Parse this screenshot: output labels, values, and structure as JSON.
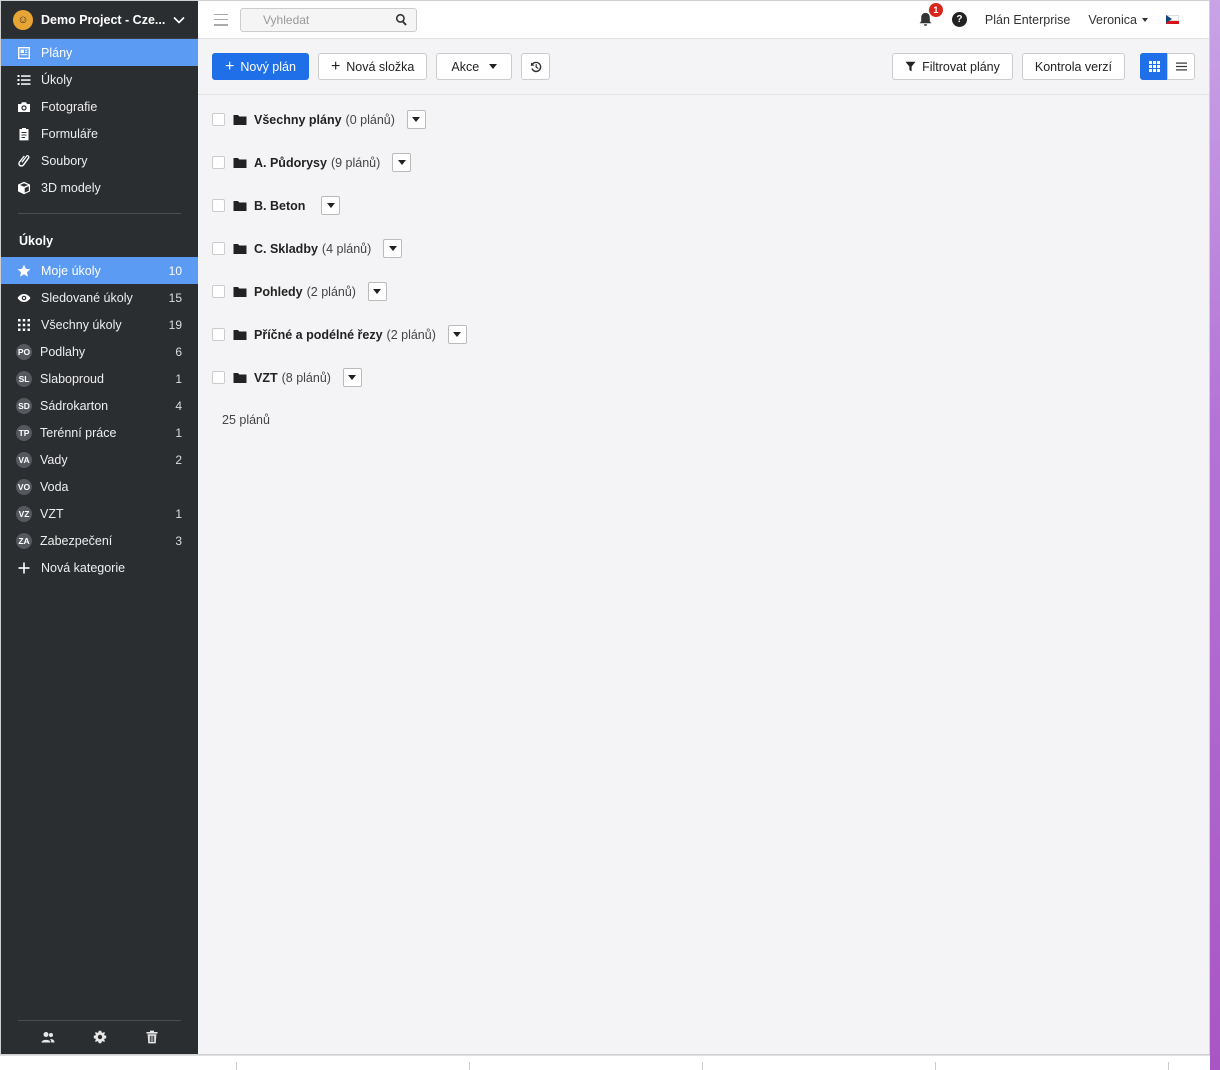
{
  "project": {
    "name": "Demo Project - Cze..."
  },
  "nav": [
    {
      "label": "Plány",
      "icon": "plans-icon",
      "active": true
    },
    {
      "label": "Úkoly",
      "icon": "list-icon"
    },
    {
      "label": "Fotografie",
      "icon": "camera-icon"
    },
    {
      "label": "Formuláře",
      "icon": "clipboard-icon"
    },
    {
      "label": "Soubory",
      "icon": "paperclip-icon"
    },
    {
      "label": "3D modely",
      "icon": "cube-icon"
    }
  ],
  "tasks_section": {
    "title": "Úkoly",
    "items": [
      {
        "label": "Moje úkoly",
        "count": "10",
        "icon": "star-icon",
        "active": true
      },
      {
        "label": "Sledované úkoly",
        "count": "15",
        "icon": "eye-icon"
      },
      {
        "label": "Všechny úkoly",
        "count": "19",
        "icon": "grid-icon"
      },
      {
        "label": "Podlahy",
        "count": "6",
        "badge": "PO"
      },
      {
        "label": "Slaboproud",
        "count": "1",
        "badge": "SL"
      },
      {
        "label": "Sádrokarton",
        "count": "4",
        "badge": "SD"
      },
      {
        "label": "Terénní práce",
        "count": "1",
        "badge": "TP"
      },
      {
        "label": "Vady",
        "count": "2",
        "badge": "VA"
      },
      {
        "label": "Voda",
        "count": "",
        "badge": "VO"
      },
      {
        "label": "VZT",
        "count": "1",
        "badge": "VZ"
      },
      {
        "label": "Zabezpečení",
        "count": "3",
        "badge": "ZA"
      }
    ],
    "new_category": "Nová kategorie"
  },
  "topbar": {
    "search_placeholder": "Vyhledat",
    "notifications": "1",
    "help": "?",
    "plan": "Plán Enterprise",
    "user": "Veronica"
  },
  "toolbar": {
    "new_plan": "Nový plán",
    "new_folder": "Nová složka",
    "actions": "Akce",
    "filter": "Filtrovat plány",
    "version_check": "Kontrola verzí"
  },
  "folders": [
    {
      "name": "Všechny plány",
      "count": "(0 plánů)"
    },
    {
      "name": "A. Půdorysy",
      "count": "(9 plánů)"
    },
    {
      "name": "B. Beton",
      "count": ""
    },
    {
      "name": "C. Skladby",
      "count": "(4 plánů)"
    },
    {
      "name": "Pohledy",
      "count": "(2 plánů)"
    },
    {
      "name": "Příčné a podélné řezy",
      "count": "(2 plánů)"
    },
    {
      "name": "VZT",
      "count": "(8 plánů)"
    }
  ],
  "total": "25 plánů",
  "colors": {
    "sidebar": "#2b2e31",
    "active": "#5b9bf4",
    "primary": "#1e6fe8",
    "notif": "#d9261c"
  }
}
